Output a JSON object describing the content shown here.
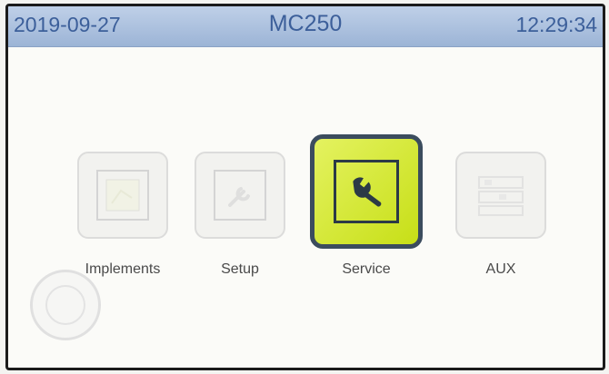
{
  "status_bar": {
    "date": "2019-09-27",
    "title": "MC250",
    "time": "12:29:34"
  },
  "menu": {
    "selected": "Service",
    "items": [
      {
        "label": "Implements",
        "icon": "implements-icon"
      },
      {
        "label": "Setup",
        "icon": "wrench-icon"
      },
      {
        "label": "Service",
        "icon": "wrench-icon"
      },
      {
        "label": "AUX",
        "icon": "aux-icon"
      }
    ]
  },
  "colors": {
    "title_bar": "#a9bfde",
    "title_text": "#3c5f9a",
    "selected_tile": "#d4e832",
    "selected_border": "#3b4c5e"
  }
}
